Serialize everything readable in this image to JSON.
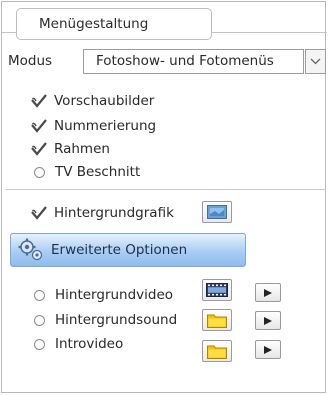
{
  "tab": {
    "label": "Menügestaltung"
  },
  "modus": {
    "label": "Modus",
    "selected": "Fotoshow- und Fotomenüs"
  },
  "options": [
    {
      "label": "Vorschaubilder",
      "checked": true
    },
    {
      "label": "Nummerierung",
      "checked": true
    },
    {
      "label": "Rahmen",
      "checked": true
    },
    {
      "label": "TV Beschnitt",
      "checked": false
    }
  ],
  "background_graphic": {
    "label": "Hintergrundgrafik",
    "checked": true
  },
  "advanced": {
    "label": "Erweiterte Optionen"
  },
  "media": [
    {
      "label": "Hintergrundvideo",
      "icon": "film-icon"
    },
    {
      "label": "Hintergrundsound",
      "icon": "folder-icon"
    },
    {
      "label": "Introvideo",
      "icon": "folder-icon"
    }
  ],
  "colors": {
    "accent": "#8fbcec",
    "check": "#4a4a4a",
    "folder": "#f2c400"
  }
}
